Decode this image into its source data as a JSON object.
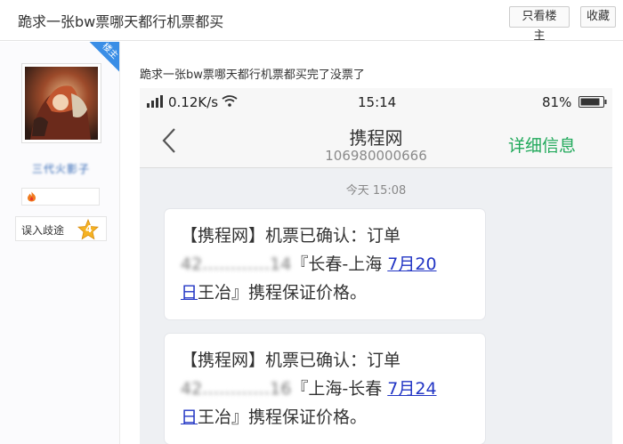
{
  "header": {
    "title": "跪求一张bw票哪天都行机票都买",
    "only_owner_button": "只看楼主",
    "favorite_button": "收藏"
  },
  "user": {
    "badge": "楼主",
    "username": "三代火影子",
    "level_title": "误入歧途",
    "level": "4"
  },
  "post": {
    "text": "跪求一张bw票哪天都行机票都买完了没票了"
  },
  "phone": {
    "status": {
      "speed": "0.12K/s",
      "time": "15:14",
      "battery": "81%"
    },
    "nav": {
      "sender": "携程网",
      "number": "106980000666",
      "details": "详细信息"
    },
    "date_separator": "今天 15:08",
    "messages": [
      {
        "line1": "【携程网】机票已确认：订单",
        "order_masked": "42…………14",
        "route": "『长春-上海",
        "date_part1": "7月20",
        "date_part2": "日",
        "tail": "王冶』携程保证价格。"
      },
      {
        "line1": "【携程网】机票已确认：订单",
        "order_masked": "42…………16",
        "route": "『上海-长春",
        "date_part1": "7月24",
        "date_part2": "日",
        "tail": "王冶』携程保证价格。"
      }
    ]
  },
  "colors": {
    "link_green": "#21a95b",
    "link_blue": "#2235c4",
    "badge_blue": "#3a8ee6"
  },
  "icons": {
    "back": "chevron-left-icon",
    "signal": "signal-icon",
    "wifi": "wifi-icon",
    "battery": "battery-icon",
    "level": "star-icon"
  }
}
